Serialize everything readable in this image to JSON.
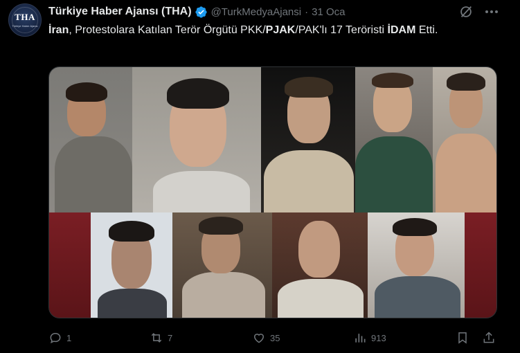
{
  "tweet": {
    "avatar_logo": "THA",
    "avatar_sub": "Türkiye Haber Ajansı",
    "display_name": "Türkiye Haber Ajansı (THA)",
    "verified_icon": "verified-badge-icon",
    "handle": "@TurkMedyaAjansi",
    "separator": "·",
    "date": "31 Oca",
    "text_parts": {
      "p1": "İran",
      "p2": ", Protestolara Katılan Terör Örgütü PKK/",
      "p3": "PJAK",
      "p4": "/PAK'lı 17 Teröristi ",
      "p5": "İDAM",
      "p6": " Etti."
    }
  },
  "actions": {
    "replies": "1",
    "reposts": "7",
    "likes": "35",
    "views": "913"
  },
  "colors": {
    "background": "#000000",
    "text": "#e7e9ea",
    "muted": "#71767b",
    "verified": "#1d9bf0"
  }
}
